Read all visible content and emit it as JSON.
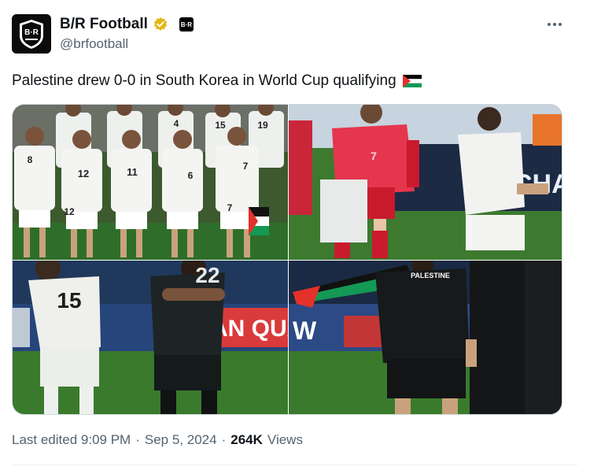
{
  "account": {
    "display_name": "B/R Football",
    "handle": "@brfootball",
    "avatar_text": "B·R",
    "affiliate_badge": "B·R"
  },
  "tweet": {
    "text": "Palestine drew 0-0 in South Korea in World Cup qualifying",
    "photos": {
      "p1": {
        "shirt_numbers": [
          "8",
          "12",
          "11",
          "6",
          "7",
          "4",
          "15",
          "19",
          "12",
          "7"
        ]
      },
      "p2": {
        "shirt_number": "7",
        "ad_text": "CHA"
      },
      "p3": {
        "shirt_number": "15",
        "shirt_number_2": "22",
        "ad_text": "AN QUA"
      },
      "p4": {
        "shirt_text": "PALESTINE",
        "ad_text": "W"
      }
    },
    "meta": {
      "edited": "Last edited 9:09 PM",
      "sep1": "·",
      "date": "Sep 5, 2024",
      "sep2": "·",
      "views_count": "264K",
      "views_label": "Views"
    }
  },
  "icons": {
    "more": "more-horizontal-icon",
    "verified": "verified-gold-badge-icon",
    "flag": "palestine-flag-icon"
  },
  "colors": {
    "verified_gold": "#e2b719",
    "text": "#0f1419",
    "secondary": "#536471"
  }
}
